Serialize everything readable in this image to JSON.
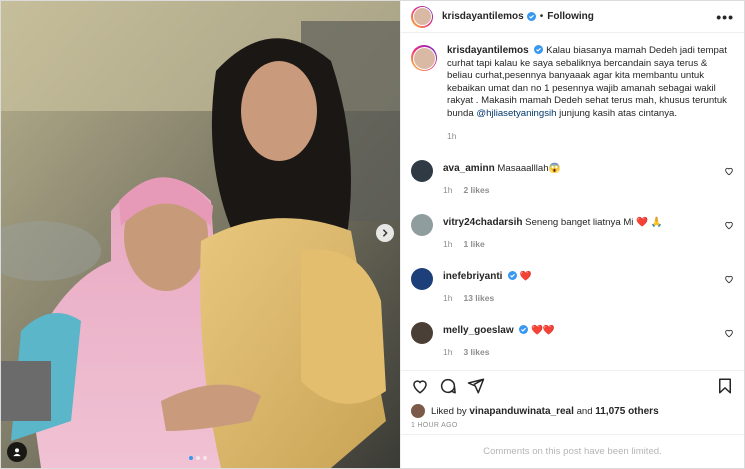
{
  "post": {
    "author": "krisdayantilemos",
    "follow_label": "Following",
    "separator": "•",
    "more_label": "•••",
    "caption_prefix": "Kalau biasanya mamah Dedeh jadi tempat curhat tapi kalau ke saya sebaliknya bercandain saya terus & beliau curhat,pesennya banyaaak agar kita membantu untuk kebaikan umat dan no 1 pesennya wajib amanah sebagai wakil rakyat . Makasih mamah Dedeh sehat terus mah, khusus teruntuk bunda",
    "caption_mention": "@hjliasetyaningsih",
    "caption_suffix": "junjung kasih atas cintanya.",
    "caption_time": "1h"
  },
  "comments": [
    {
      "user": "ava_aminn",
      "verified": false,
      "text": "Masaaalllah😱",
      "time": "1h",
      "likes": "2 likes"
    },
    {
      "user": "vitry24chadarsih",
      "verified": false,
      "text": "Seneng banget liatnya Mi ❤️ 🙏",
      "time": "1h",
      "likes": "1 like"
    },
    {
      "user": "inefebriyanti",
      "verified": true,
      "text": "❤️",
      "time": "1h",
      "likes": "13 likes"
    },
    {
      "user": "melly_goeslaw",
      "verified": true,
      "text": "❤️❤️",
      "time": "1h",
      "likes": "3 likes"
    }
  ],
  "likes": {
    "prefix": "Liked by",
    "user": "vinapanduwinata_real",
    "middle": "and",
    "others": "11,075 others"
  },
  "timestamp": "1 HOUR AGO",
  "comments_limited": "Comments on this post have been limited.",
  "colors": {
    "verified": "#3897f0",
    "heart": "#ed4956",
    "mention": "#00376b",
    "muted": "#8e8e8e",
    "carousel_active": "#3897f0"
  },
  "icons": [
    "heart-icon",
    "comment-icon",
    "share-icon",
    "bookmark-icon",
    "chevron-right-icon",
    "user-tag-icon",
    "verified-icon"
  ]
}
